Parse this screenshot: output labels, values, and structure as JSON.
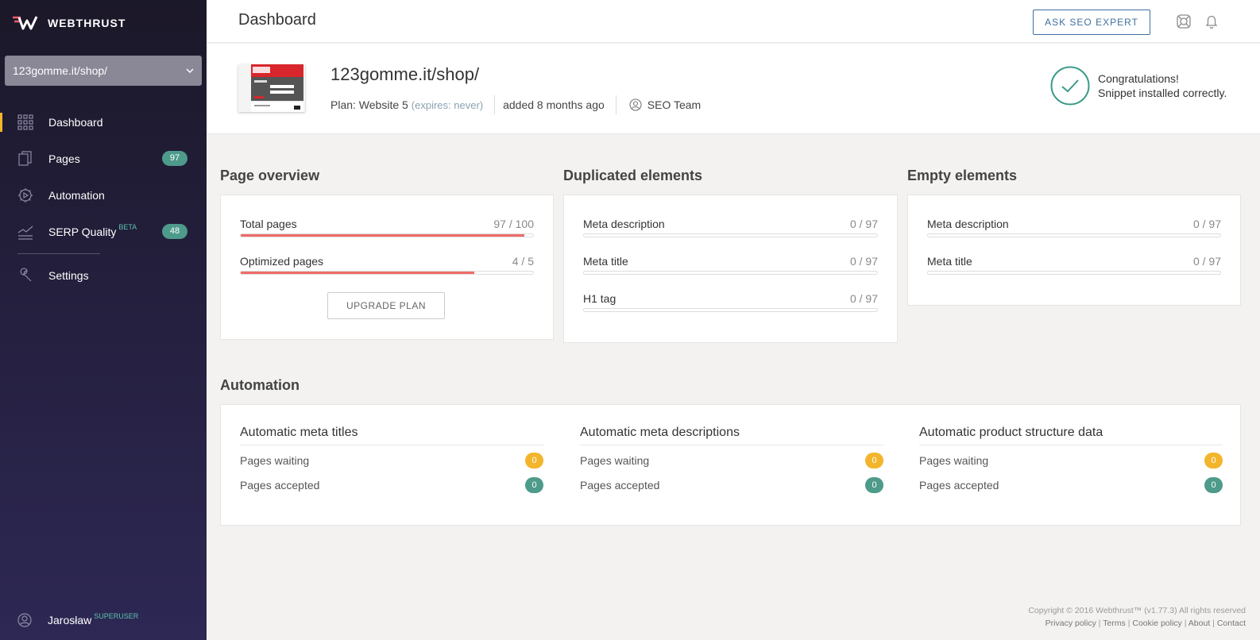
{
  "brand": {
    "name": "WEBTHRUST"
  },
  "site_selector": {
    "value": "123gomme.it/shop/"
  },
  "nav": [
    {
      "label": "Dashboard",
      "icon": "grid-icon",
      "active": true
    },
    {
      "label": "Pages",
      "icon": "pages-icon",
      "badge": "97"
    },
    {
      "label": "Automation",
      "icon": "automation-icon"
    },
    {
      "label": "SERP Quality",
      "icon": "serp-chart-icon",
      "tag": "BETA",
      "badge": "48"
    },
    {
      "label": "Settings",
      "icon": "wrench-icon"
    }
  ],
  "user": {
    "name": "Jarosław",
    "role": "SUPERUSER"
  },
  "topbar": {
    "title": "Dashboard",
    "ask_button": "ASK SEO EXPERT"
  },
  "site": {
    "name": "123gomme.it/shop/",
    "plan": "Plan: Website 5",
    "expires": "(expires: never)",
    "added": "added 8 months ago",
    "team": "SEO Team"
  },
  "status": {
    "line1": "Congratulations!",
    "line2": "Snippet installed correctly.",
    "color": "#3a9a88"
  },
  "page_overview": {
    "title": "Page overview",
    "stats": [
      {
        "label": "Total pages",
        "value": "97 / 100",
        "fraction": 0.97
      },
      {
        "label": "Optimized pages",
        "value": "4 / 5",
        "fraction": 0.8
      }
    ],
    "upgrade_button": "UPGRADE PLAN"
  },
  "duplicated": {
    "title": "Duplicated elements",
    "stats": [
      {
        "label": "Meta description",
        "value": "0 / 97",
        "fraction": 0
      },
      {
        "label": "Meta title",
        "value": "0 / 97",
        "fraction": 0
      },
      {
        "label": "H1 tag",
        "value": "0 / 97",
        "fraction": 0
      }
    ]
  },
  "empty": {
    "title": "Empty elements",
    "stats": [
      {
        "label": "Meta description",
        "value": "0 / 97",
        "fraction": 0
      },
      {
        "label": "Meta title",
        "value": "0 / 97",
        "fraction": 0
      }
    ]
  },
  "automation": {
    "title": "Automation",
    "columns": [
      {
        "title": "Automatic meta titles",
        "waiting_label": "Pages waiting",
        "waiting": "0",
        "accepted_label": "Pages accepted",
        "accepted": "0"
      },
      {
        "title": "Automatic meta descriptions",
        "waiting_label": "Pages waiting",
        "waiting": "0",
        "accepted_label": "Pages accepted",
        "accepted": "0"
      },
      {
        "title": "Automatic product structure data",
        "waiting_label": "Pages waiting",
        "waiting": "0",
        "accepted_label": "Pages accepted",
        "accepted": "0"
      }
    ]
  },
  "footer": {
    "copyright": "Copyright © 2016 Webthrust™ (v1.77.3) All rights reserved",
    "links": [
      "Privacy policy",
      "Terms",
      "Cookie policy",
      "About",
      "Contact"
    ]
  },
  "colors": {
    "accent_red": "#ef6b68",
    "teal": "#4e9a8b",
    "yellow": "#f3b52b",
    "blue": "#3d6f9e"
  }
}
